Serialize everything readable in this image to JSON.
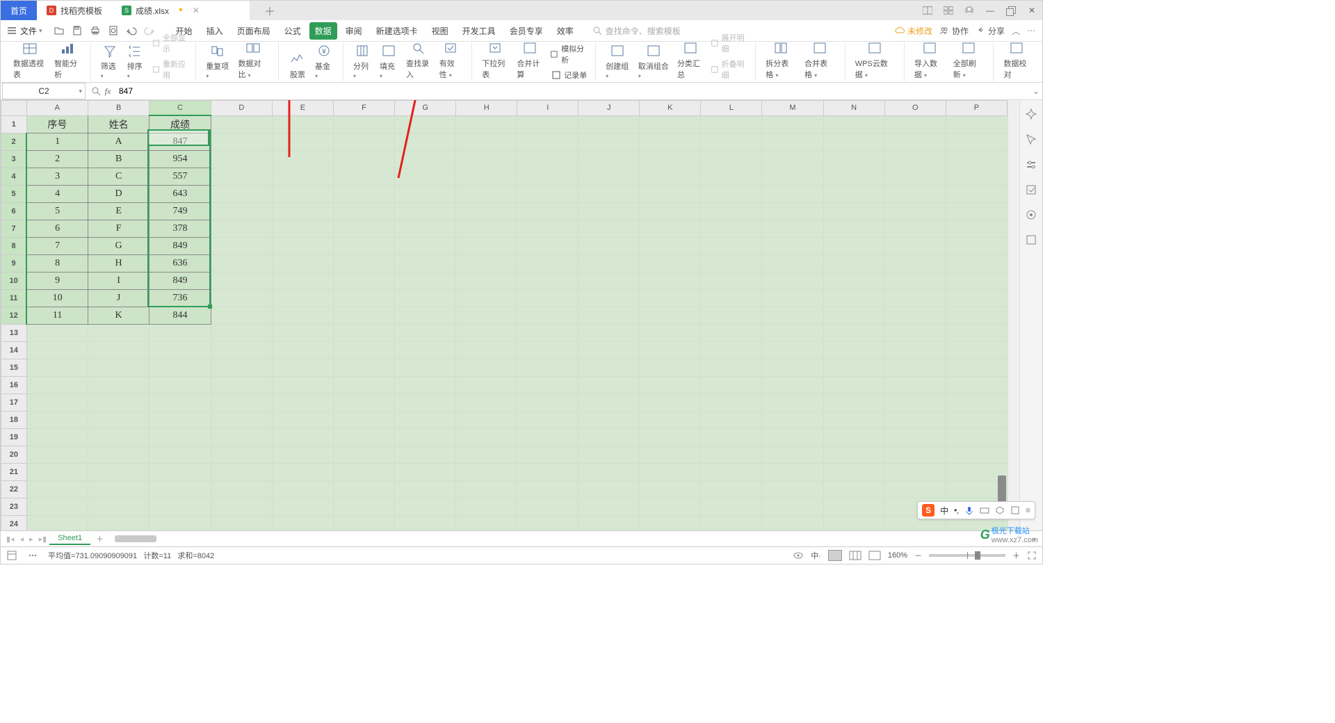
{
  "tabs": {
    "home": "首页",
    "t1": "找稻壳模板",
    "t2": "成绩.xlsx"
  },
  "file_label": "文件",
  "menu": [
    "开始",
    "插入",
    "页面布局",
    "公式",
    "数据",
    "审阅",
    "新建选项卡",
    "视图",
    "开发工具",
    "会员专享",
    "效率"
  ],
  "menu_active_index": 4,
  "search_placeholder": "查找命令、搜索模板",
  "top_right": {
    "unsaved": "未修改",
    "coop": "协作",
    "share": "分享"
  },
  "ribbon": [
    "数据透视表",
    "智能分析",
    "筛选",
    "全部显示",
    "重新应用",
    "排序",
    "重复项",
    "数据对比",
    "股票",
    "基金",
    "分列",
    "填充",
    "查找录入",
    "有效性",
    "下拉列表",
    "合并计算",
    "模拟分析",
    "记录单",
    "创建组",
    "取消组合",
    "分类汇总",
    "展开明细",
    "折叠明细",
    "拆分表格",
    "合并表格",
    "WPS云数据",
    "导入数据",
    "全部刷新",
    "数据校对"
  ],
  "namebox": "C2",
  "fx_value": "847",
  "columns": [
    "A",
    "B",
    "C",
    "D",
    "E",
    "F",
    "G",
    "H",
    "I",
    "J",
    "K",
    "L",
    "M",
    "N",
    "O",
    "P"
  ],
  "row_count": 27,
  "table": {
    "headers": [
      "序号",
      "姓名",
      "成绩"
    ],
    "rows": [
      [
        "1",
        "A",
        "847"
      ],
      [
        "2",
        "B",
        "954"
      ],
      [
        "3",
        "C",
        "557"
      ],
      [
        "4",
        "D",
        "643"
      ],
      [
        "5",
        "E",
        "749"
      ],
      [
        "6",
        "F",
        "378"
      ],
      [
        "7",
        "G",
        "849"
      ],
      [
        "8",
        "H",
        "636"
      ],
      [
        "9",
        "I",
        "849"
      ],
      [
        "10",
        "J",
        "736"
      ],
      [
        "11",
        "K",
        "844"
      ]
    ]
  },
  "sheet_tab": "Sheet1",
  "status": {
    "avg_label": "平均值",
    "avg": "731.09090909091",
    "count_label": "计数",
    "count": "11",
    "sum_label": "求和",
    "sum": "8042",
    "zoom": "160%"
  },
  "ime": {
    "lang": "中"
  },
  "watermark": {
    "brand": "极光下载站",
    "url": "www.xz7.com"
  }
}
